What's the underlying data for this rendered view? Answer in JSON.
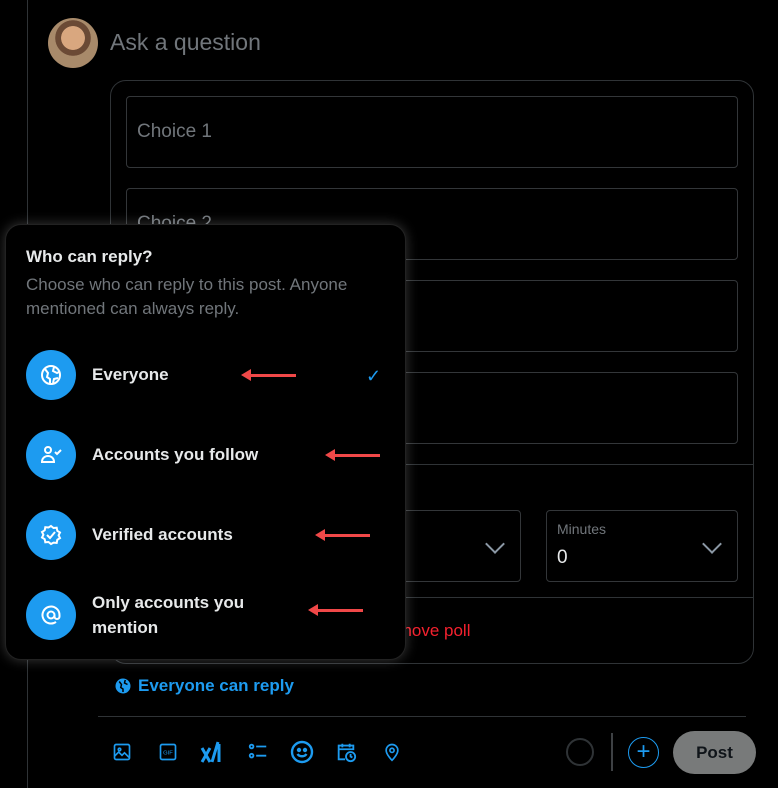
{
  "composer": {
    "placeholder": "Ask a question"
  },
  "poll": {
    "choices": [
      "Choice 1",
      "Choice 2"
    ],
    "minutes_label": "Minutes",
    "minutes_value": "0",
    "remove_label": "Remove poll"
  },
  "reply_popup": {
    "title": "Who can reply?",
    "subtitle": "Choose who can reply to this post. Anyone mentioned can always reply.",
    "options": [
      {
        "label": "Everyone",
        "icon": "globe-icon",
        "selected": true
      },
      {
        "label": "Accounts you follow",
        "icon": "person-check-icon"
      },
      {
        "label": "Verified accounts",
        "icon": "verified-badge-icon"
      },
      {
        "label": "Only accounts you mention",
        "icon": "at-icon"
      }
    ]
  },
  "reply_setting": "Everyone can reply",
  "toolbar": {
    "icons": [
      "image-icon",
      "gif-icon",
      "grok-icon",
      "poll-icon",
      "emoji-icon",
      "schedule-icon",
      "location-icon"
    ],
    "post_label": "Post"
  },
  "colors": {
    "accent": "#1d9bf0",
    "danger": "#f4212e",
    "annotation_arrow": "#f04848"
  }
}
